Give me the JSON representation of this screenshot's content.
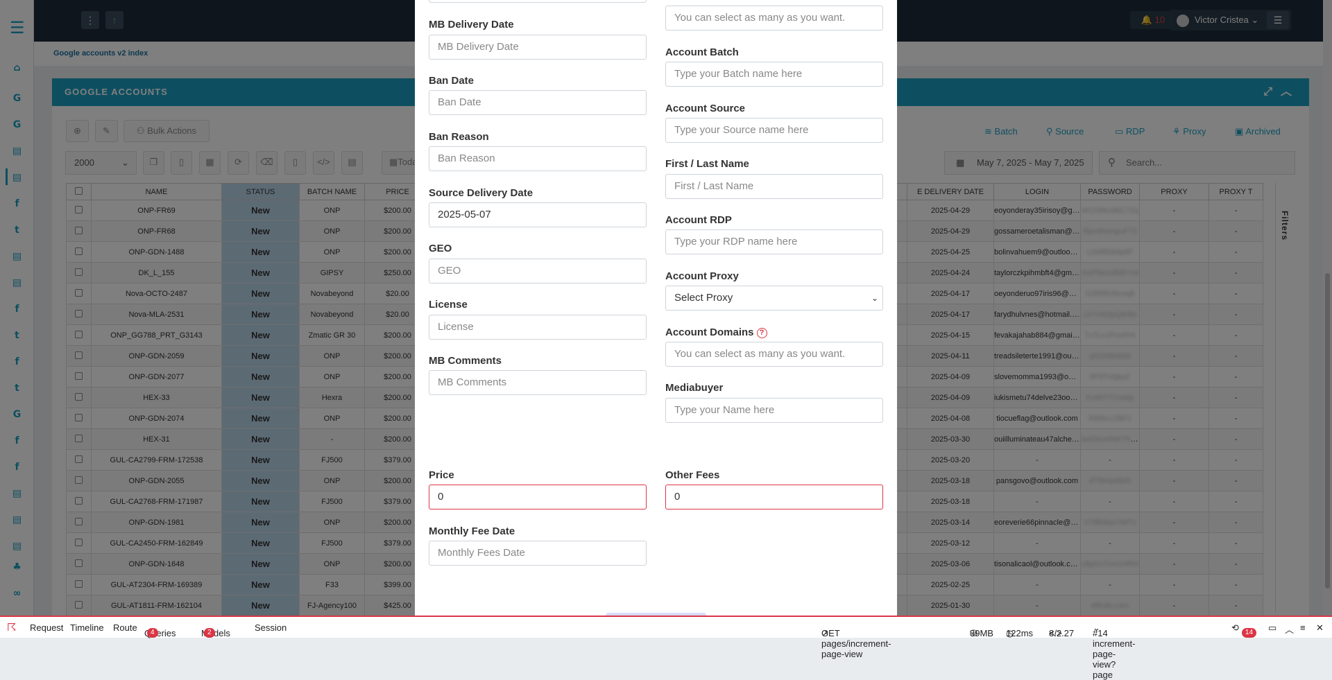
{
  "topbar": {
    "notifications": "10",
    "user_name": "Victor Cristea"
  },
  "breadcrumb": "Google accounts v2 index",
  "card": {
    "title": "GOOGLE ACCOUNTS"
  },
  "toolbar": {
    "bulk_actions": "Bulk Actions",
    "per_page": "2000",
    "today": "Toda",
    "date_range": "May 7, 2025 - May 7, 2025",
    "search_placeholder": "Search..."
  },
  "right_links": [
    "Batch",
    "Source",
    "RDP",
    "Proxy",
    "Archived"
  ],
  "table": {
    "headers": [
      "NAME",
      "STATUS",
      "BATCH NAME",
      "PRICE",
      "E DELIVERY DATE",
      "LOGIN",
      "PASSWORD",
      "PROXY",
      "PROXY T"
    ],
    "rows": [
      {
        "name": "ONP-FR69",
        "status": "New",
        "batch": "ONP",
        "price": "$200.00",
        "date": "2025-04-29",
        "login": "eoyonderay35irisoy@gmail.c...",
        "password": "W1X8bUd6C7Zq",
        "proxy": "-",
        "proxy_t": "-"
      },
      {
        "name": "ONP-FR68",
        "status": "New",
        "batch": "ONP",
        "price": "$200.00",
        "date": "2025-04-29",
        "login": "gossameroetalisman@gmail....",
        "password": "Rpv4hsmpuF73",
        "proxy": "-",
        "proxy_t": "-"
      },
      {
        "name": "ONP-GDN-1488",
        "status": "New",
        "batch": "ONP",
        "price": "$200.00",
        "date": "2025-04-25",
        "login": "bolinvahuem9@outlook.com",
        "password": "c1M6f0d4p8F",
        "proxy": "-",
        "proxy_t": "-"
      },
      {
        "name": "DK_L_155",
        "status": "New",
        "batch": "GIPSY",
        "price": "$250.00",
        "date": "2025-04-24",
        "login": "taylorczkpihmbft4@gmail.com",
        "password": "XwPbkzv8kBYs4",
        "proxy": "-",
        "proxy_t": "-"
      },
      {
        "name": "Nova-OCTO-2487",
        "status": "New",
        "batch": "Novabeyond",
        "price": "$20.00",
        "date": "2025-04-17",
        "login": "oeyonderuo97iris96@gmail.c...",
        "password": "G3t5f8Vbnsq8",
        "proxy": "-",
        "proxy_t": "-"
      },
      {
        "name": "Nova-MLA-2531",
        "status": "New",
        "batch": "Novabeyond",
        "price": "$20.00",
        "date": "2025-04-17",
        "login": "farydhulvnes@hotmail.com",
        "password": "Lk7mN3pQ8rBs",
        "proxy": "-",
        "proxy_t": "-"
      },
      {
        "name": "ONP_GG788_PRT_G3143",
        "status": "New",
        "batch": "Zmatic GR 30",
        "price": "$200.00",
        "date": "2025-04-15",
        "login": "fevakajahab884@gmail.com",
        "password": "Tz7Lu1Pzx9Yk",
        "proxy": "-",
        "proxy_t": "-"
      },
      {
        "name": "ONP-GDN-2059",
        "status": "New",
        "batch": "ONP",
        "price": "$200.00",
        "date": "2025-04-11",
        "login": "treadsileterte1991@outlook.c...",
        "password": "qN2b8k6bM",
        "proxy": "-",
        "proxy_t": "-"
      },
      {
        "name": "ONP-GDN-2077",
        "status": "New",
        "batch": "ONP",
        "price": "$200.00",
        "date": "2025-04-09",
        "login": "slovemomma1993@outlook....",
        "password": "8F9Tv6jkpZ",
        "proxy": "-",
        "proxy_t": "-"
      },
      {
        "name": "HEX-33",
        "status": "New",
        "batch": "Hexra",
        "price": "$200.00",
        "date": "2025-04-09",
        "login": "iukismetu74delve23oo@gmai...",
        "password": "Kx4kT7Cnsdp",
        "proxy": "-",
        "proxy_t": "-"
      },
      {
        "name": "ONP-GDN-2074",
        "status": "New",
        "batch": "ONP",
        "price": "$200.00",
        "date": "2025-04-08",
        "login": "tiocueflag@outlook.com",
        "password": "R8t8v1ZBF2",
        "proxy": "-",
        "proxy_t": "-"
      },
      {
        "name": "HEX-31",
        "status": "New",
        "batch": "-",
        "price": "$200.00",
        "date": "2025-03-30",
        "login": "ouiilluminateau47alchemy@g...",
        "password": "IadI3xuHNKTkwfr4",
        "proxy": "-",
        "proxy_t": "-"
      },
      {
        "name": "GUL-CA2799-FRM-172538",
        "status": "New",
        "batch": "FJ500",
        "price": "$379.00",
        "date": "2025-03-20",
        "login": "-",
        "password": "-",
        "proxy": "-",
        "proxy_t": "-"
      },
      {
        "name": "ONP-GDN-2055",
        "status": "New",
        "batch": "ONP",
        "price": "$200.00",
        "date": "2025-03-18",
        "login": "pansgovo@outlook.com",
        "password": "dT8k4p6iM5",
        "proxy": "-",
        "proxy_t": "-"
      },
      {
        "name": "GUL-CA2768-FRM-171987",
        "status": "New",
        "batch": "FJ500",
        "price": "$379.00",
        "date": "2025-03-18",
        "login": "-",
        "password": "-",
        "proxy": "-",
        "proxy_t": "-"
      },
      {
        "name": "ONP-GDN-1981",
        "status": "New",
        "batch": "ONP",
        "price": "$200.00",
        "date": "2025-03-14",
        "login": "eoreverie66pinnacle@gmail....",
        "password": "V7fBt4kp7rMTz",
        "proxy": "-",
        "proxy_t": "-"
      },
      {
        "name": "GUL-CA2450-FRM-162849",
        "status": "New",
        "batch": "FJ500",
        "price": "$379.00",
        "date": "2025-03-12",
        "login": "-",
        "password": "-",
        "proxy": "-",
        "proxy_t": "-"
      },
      {
        "name": "ONP-GDN-1648",
        "status": "New",
        "batch": "ONP",
        "price": "$200.00",
        "date": "2025-03-06",
        "login": "tisonalicaol@outlook.com",
        "password": "u8pGv7cm1HRH",
        "proxy": "-",
        "proxy_t": "-"
      },
      {
        "name": "GUL-AT2304-FRM-169389",
        "status": "New",
        "batch": "F33",
        "price": "$399.00",
        "date": "2025-02-25",
        "login": "-",
        "password": "-",
        "proxy": "-",
        "proxy_t": "-"
      },
      {
        "name": "GUL-AT1811-FRM-162104",
        "status": "New",
        "batch": "FJ-Agency100",
        "price": "$425.00",
        "date": "2025-01-30",
        "login": "-",
        "password": "d8hdb.com",
        "proxy": "-",
        "proxy_t": "-"
      }
    ]
  },
  "filters_label": "Filters",
  "modal": {
    "left": {
      "mb_delivery_label": "MB Delivery Date",
      "mb_delivery_ph": "MB Delivery Date",
      "ban_date_label": "Ban Date",
      "ban_date_ph": "Ban Date",
      "ban_reason_label": "Ban Reason",
      "ban_reason_ph": "Ban Reason",
      "source_delivery_label": "Source Delivery Date",
      "source_delivery_value": "2025-05-07",
      "geo_label": "GEO",
      "geo_ph": "GEO",
      "license_label": "License",
      "license_ph": "License",
      "mb_comments_label": "MB Comments",
      "mb_comments_ph": "MB Comments",
      "price_label": "Price",
      "price_value": "0",
      "monthly_label": "Monthly Fee Date",
      "monthly_ph": "Monthly Fees Date"
    },
    "right": {
      "top_ph": "You can select as many as you want.",
      "batch_label": "Account Batch",
      "batch_ph": "Type your Batch name here",
      "source_label": "Account Source",
      "source_ph": "Type your Source name here",
      "name_label": "First / Last Name",
      "name_ph": "First / Last Name",
      "rdp_label": "Account RDP",
      "rdp_ph": "Type your RDP name here",
      "proxy_label": "Account Proxy",
      "proxy_value": "Select Proxy",
      "domains_label": "Account Domains",
      "domains_ph": "You can select as many as you want.",
      "mediabuyer_label": "Mediabuyer",
      "mediabuyer_ph": "Type your Name here",
      "other_fees_label": "Other Fees",
      "other_fees_value": "0"
    }
  },
  "debugbar": {
    "request": "Request",
    "timeline": "Timeline",
    "route": "Route",
    "queries": "Queries",
    "queries_count": "4",
    "models": "Models",
    "models_count": "2",
    "session": "Session",
    "get": "GET pages/increment-page-view",
    "memory": "39MB",
    "time": "122ms",
    "php": "8.2.27",
    "page": "#14 increment-page-view?page",
    "count": "14"
  }
}
